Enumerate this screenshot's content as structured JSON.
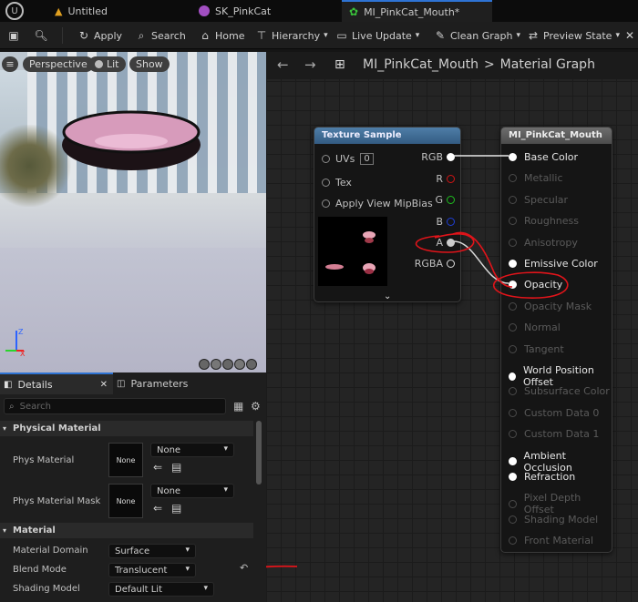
{
  "tabs": [
    {
      "label": "Untitled"
    },
    {
      "label": "SK_PinkCat"
    },
    {
      "label": "MI_PinkCat_Mouth*"
    }
  ],
  "toolbar": {
    "apply": "Apply",
    "search": "Search",
    "home": "Home",
    "hierarchy": "Hierarchy",
    "live_update": "Live Update",
    "clean_graph": "Clean Graph",
    "preview_state": "Preview State"
  },
  "viewport": {
    "perspective": "Perspective",
    "lit": "Lit",
    "show": "Show"
  },
  "breadcrumb": {
    "asset": "MI_PinkCat_Mouth",
    "separator": ">",
    "graph": "Material Graph"
  },
  "texture_node": {
    "title": "Texture Sample",
    "uvs": "UVs",
    "uvs_value": "0",
    "tex": "Tex",
    "mip": "Apply View MipBias",
    "outputs": [
      "RGB",
      "R",
      "G",
      "B",
      "A",
      "RGBA"
    ]
  },
  "material_node": {
    "title": "MI_PinkCat_Mouth",
    "pins": [
      {
        "label": "Base Color",
        "active": true
      },
      {
        "label": "Metallic",
        "active": false
      },
      {
        "label": "Specular",
        "active": false
      },
      {
        "label": "Roughness",
        "active": false
      },
      {
        "label": "Anisotropy",
        "active": false
      },
      {
        "label": "Emissive Color",
        "active": true
      },
      {
        "label": "Opacity",
        "active": true
      },
      {
        "label": "Opacity Mask",
        "active": false
      },
      {
        "label": "Normal",
        "active": false
      },
      {
        "label": "Tangent",
        "active": false
      },
      {
        "label": "World Position Offset",
        "active": true
      },
      {
        "label": "Subsurface Color",
        "active": false
      },
      {
        "label": "Custom Data 0",
        "active": false
      },
      {
        "label": "Custom Data 1",
        "active": false
      },
      {
        "label": "Ambient Occlusion",
        "active": true
      },
      {
        "label": "Refraction",
        "active": true
      },
      {
        "label": "Pixel Depth Offset",
        "active": false
      },
      {
        "label": "Shading Model",
        "active": false
      },
      {
        "label": "Front Material",
        "active": false
      }
    ]
  },
  "details": {
    "tab": "Details",
    "params_tab": "Parameters",
    "search_placeholder": "Search",
    "physical_material": "Physical Material",
    "phys_material": "Phys Material",
    "phys_material_mask": "Phys Material Mask",
    "none": "None",
    "thumb_none": "None",
    "material": "Material",
    "material_domain": "Material Domain",
    "material_domain_value": "Surface",
    "blend_mode": "Blend Mode",
    "blend_mode_value": "Translucent",
    "shading_model": "Shading Model",
    "shading_model_value": "Default Lit"
  },
  "colors": {
    "accent": "#2e73d4",
    "annotation": "#e0141a",
    "r": "#d21414",
    "g": "#1fbf1f",
    "b": "#1f3fd6"
  }
}
